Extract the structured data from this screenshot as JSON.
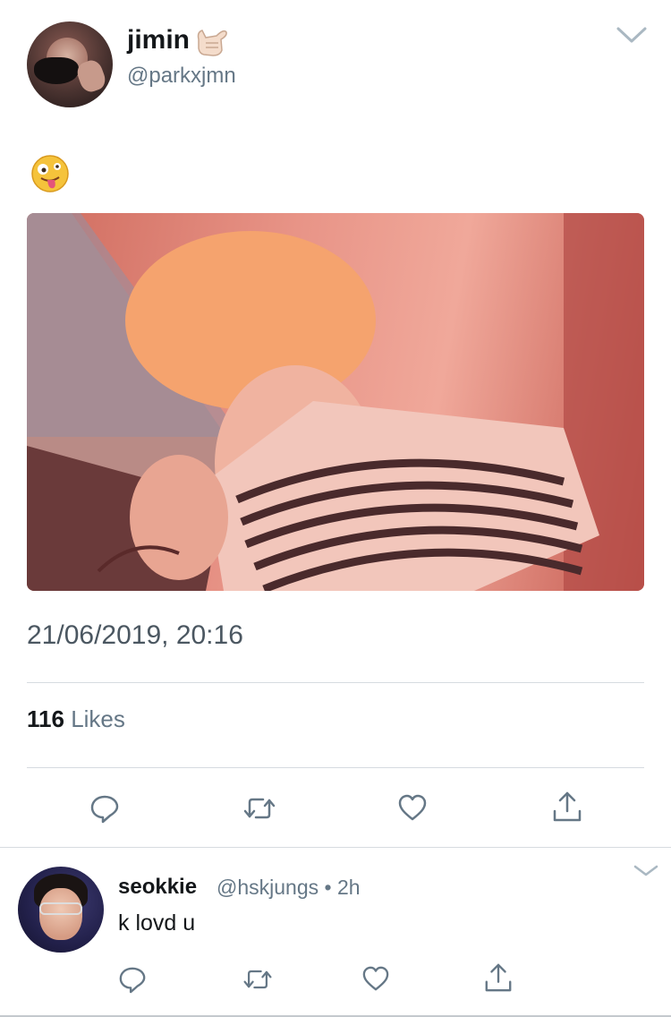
{
  "tweet": {
    "author_name": "jimin",
    "author_handle": "@parkxjmn",
    "name_emoji_icon": "call-me-hand-emoji",
    "body_emoji_icon": "zany-face-emoji",
    "image_icon": "tweet-photo",
    "timestamp": "21/06/2019, 20:16",
    "likes_count": "116",
    "likes_label": "Likes"
  },
  "actions": [
    "reply-icon",
    "retweet-icon",
    "like-icon",
    "share-icon"
  ],
  "reply": {
    "author_name": "seokkie",
    "meta": "@hskjungs • 2h",
    "text": "k lovd u"
  },
  "colors": {
    "primary_text": "#14171a",
    "secondary_text": "#657786",
    "divider": "#d6dbe0",
    "icon": "#657786"
  }
}
